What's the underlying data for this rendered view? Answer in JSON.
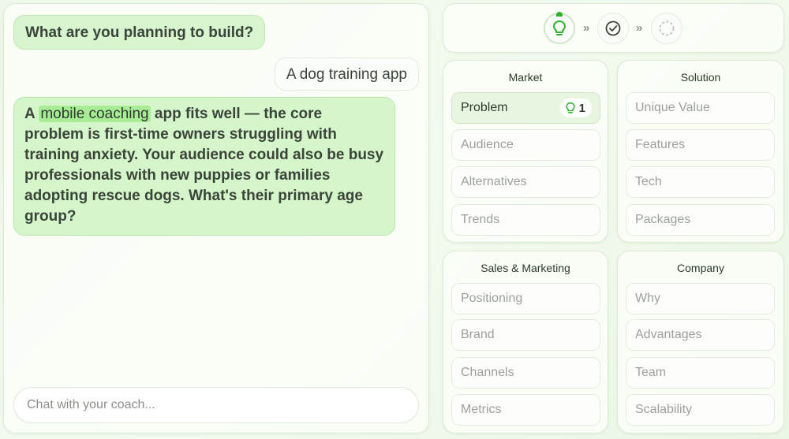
{
  "chat": {
    "question": "What are you planning to build?",
    "answer": "A dog training app",
    "coach_prefix": "A",
    "coach_highlight": "mobile coaching",
    "coach_rest": "app fits well — the core problem is first-time owners struggling with training anxiety. Your audience could also be busy professionals with new puppies or families adopting rescue dogs. What's their primary age group?",
    "input_placeholder": "Chat with your coach..."
  },
  "progress": {
    "steps": [
      "lightbulb-icon",
      "check-circle-icon",
      "dashed-circle-icon"
    ],
    "separator": "»",
    "accent": "#2fb22f"
  },
  "sections": {
    "market": {
      "title": "Market",
      "items": [
        "Problem",
        "Audience",
        "Alternatives",
        "Trends"
      ],
      "active_badge": "1"
    },
    "solution": {
      "title": "Solution",
      "items": [
        "Unique Value",
        "Features",
        "Tech",
        "Packages"
      ]
    },
    "sales": {
      "title": "Sales & Marketing",
      "items": [
        "Positioning",
        "Brand",
        "Channels",
        "Metrics"
      ]
    },
    "company": {
      "title": "Company",
      "items": [
        "Why",
        "Advantages",
        "Team",
        "Scalability"
      ]
    }
  }
}
